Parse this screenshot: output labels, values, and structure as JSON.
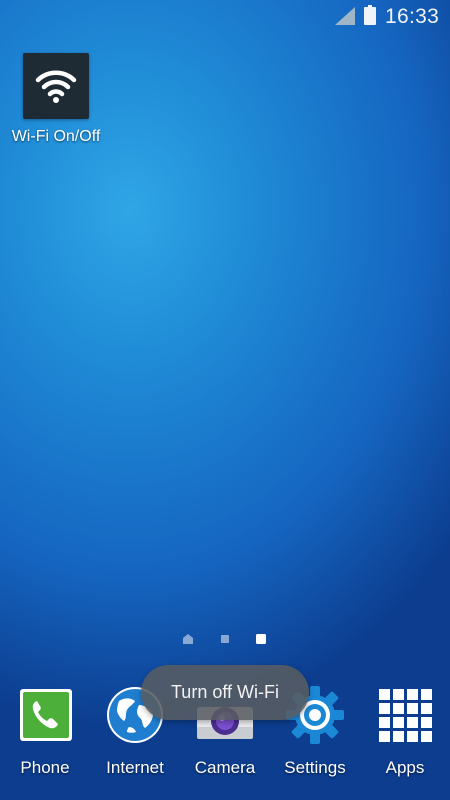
{
  "status_bar": {
    "time": "16:33",
    "signal_icon": "signal-strength-icon",
    "battery_icon": "battery-icon"
  },
  "widget": {
    "label": "Wi-Fi On/Off",
    "icon": "wifi-icon"
  },
  "page_indicator": {
    "pages": [
      "home",
      "page",
      "page"
    ],
    "active_index": 2
  },
  "dock": {
    "items": [
      {
        "label": "Phone",
        "icon": "phone-icon"
      },
      {
        "label": "Internet",
        "icon": "globe-icon"
      },
      {
        "label": "Camera",
        "icon": "camera-icon"
      },
      {
        "label": "Settings",
        "icon": "gear-icon"
      },
      {
        "label": "Apps",
        "icon": "apps-grid-icon"
      }
    ]
  },
  "toast": {
    "message": "Turn off Wi-Fi"
  },
  "colors": {
    "wallpaper_top": "#2fa6e6",
    "wallpaper_bottom": "#0c3d8f",
    "widget_tile": "#1e2b35",
    "phone_green": "#4caf3a",
    "settings_blue": "#1b88d6",
    "toast_bg": "#585c62"
  }
}
